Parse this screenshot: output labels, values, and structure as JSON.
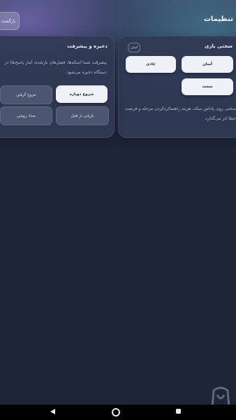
{
  "header": {
    "title": "تنظیمات",
    "back_label": "بازگشت"
  },
  "difficulty": {
    "title": "سختی بازی",
    "current_badge": "آسان",
    "options": [
      "آسان",
      "عادی",
      "سخت"
    ],
    "description": "سختی روی پاداش سکه، هزینه راهنما/ردکردن مرحله و فرصت خطا اثر می‌گذارد."
  },
  "save": {
    "title": "ذخیره و پیشرفت",
    "description": "پیشرفت شما (سکه‌ها، فصل‌های بازشده، آمار پاسخ‌ها) در دستگاه ذخیره می‌شود.",
    "restart_label": "شروع دوباره",
    "quit_label": "خروج گرفتن",
    "recover_label": "بازیابی از فایل",
    "sound_label": "صدا: روشن"
  },
  "watermark": "بازار",
  "colors": {
    "background": "#1e2537",
    "card": "#303954",
    "button_light": "#eef1f5"
  }
}
